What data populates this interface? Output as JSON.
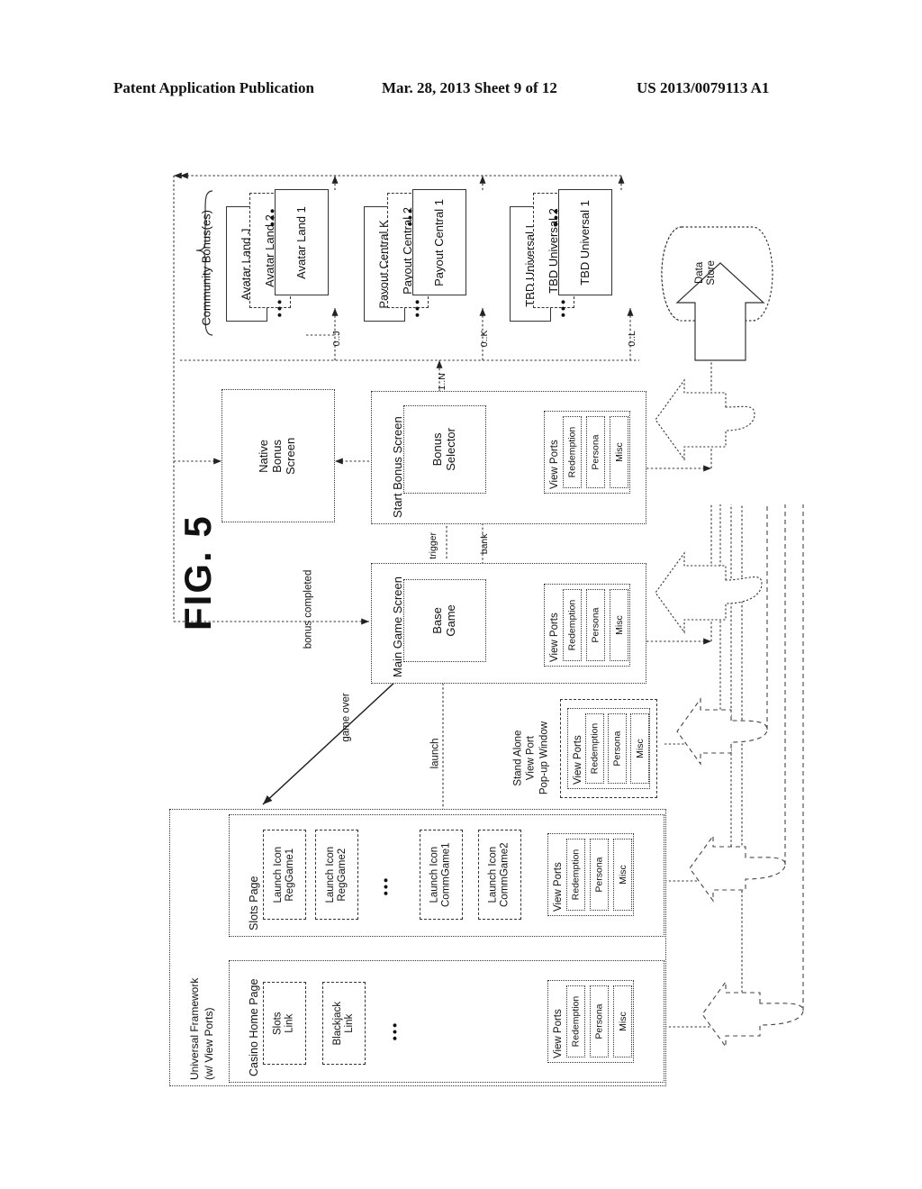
{
  "header": {
    "publication": "Patent Application Publication",
    "date_sheet": "Mar. 28, 2013  Sheet 9 of 12",
    "patent_number": "US 2013/0079113 A1"
  },
  "figure": {
    "label": "FIG. 5"
  },
  "community_bonuses": {
    "bracket_label": "Community Bonus(es)",
    "groups": [
      {
        "name": "avatar-land",
        "cardinality": "0..J",
        "instances": [
          "Avatar Land 1",
          "Avatar Land 2",
          "Avatar Land J"
        ],
        "ellipsis": "•••"
      },
      {
        "name": "payout-central",
        "cardinality": "0..K",
        "instances": [
          "Payout Central 1",
          "Payout Central 2",
          "Payout Central K"
        ],
        "ellipsis": "•••"
      },
      {
        "name": "tbd-universal",
        "cardinality": "0..L",
        "instances": [
          "TBD Universal 1",
          "TBD Universal 2",
          "TBD Universal L"
        ],
        "ellipsis": "•••"
      }
    ]
  },
  "data_store": {
    "label": "Data\nStore",
    "line1": "Data",
    "line2": "Store"
  },
  "native_bonus_screen": {
    "label": "Native\nBonus\nScreen",
    "l1": "Native",
    "l2": "Bonus",
    "l3": "Screen"
  },
  "start_bonus_screen": {
    "title": "Start Bonus Screen",
    "selector": {
      "l1": "Bonus",
      "l2": "Selector"
    },
    "view_ports": {
      "title": "View Ports",
      "items": [
        "Redemption",
        "Persona",
        "Misc"
      ]
    }
  },
  "main_game_screen": {
    "title": "Main Game Screen",
    "base_game": {
      "l1": "Base",
      "l2": "Game"
    },
    "view_ports": {
      "title": "View Ports",
      "items": [
        "Redemption",
        "Persona",
        "Misc"
      ]
    }
  },
  "standalone_popup": {
    "title_l1": "Stand Alone",
    "title_l2": "View Port",
    "title_l3": "Pop-up Window",
    "view_ports": {
      "title": "View Ports",
      "items": [
        "Redemption",
        "Persona",
        "Misc"
      ]
    }
  },
  "universal_framework": {
    "title_l1": "Universal Framework",
    "title_l2": "(w/ View Ports)"
  },
  "slots_page": {
    "title": "Slots Page",
    "ellipsis": "•••",
    "launch_icons": [
      {
        "l1": "Launch Icon",
        "l2": "RegGame1"
      },
      {
        "l1": "Launch Icon",
        "l2": "RegGame2"
      },
      {
        "l1": "Launch Icon",
        "l2": "CommGame1"
      },
      {
        "l1": "Launch Icon",
        "l2": "CommGame2"
      }
    ],
    "view_ports": {
      "title": "View Ports",
      "items": [
        "Redemption",
        "Persona",
        "Misc"
      ]
    }
  },
  "casino_home_page": {
    "title": "Casino Home Page",
    "ellipsis": "•••",
    "links": [
      {
        "l1": "Slots",
        "l2": "Link"
      },
      {
        "l1": "Blackjack",
        "l2": "Link"
      }
    ],
    "view_ports": {
      "title": "View Ports",
      "items": [
        "Redemption",
        "Persona",
        "Misc"
      ]
    }
  },
  "edge_labels": {
    "one_to_n": "1..N",
    "trigger": "trigger",
    "bank": "bank",
    "bonus_completed": "bonus  completed",
    "game_over": "game over",
    "launch": "launch"
  }
}
